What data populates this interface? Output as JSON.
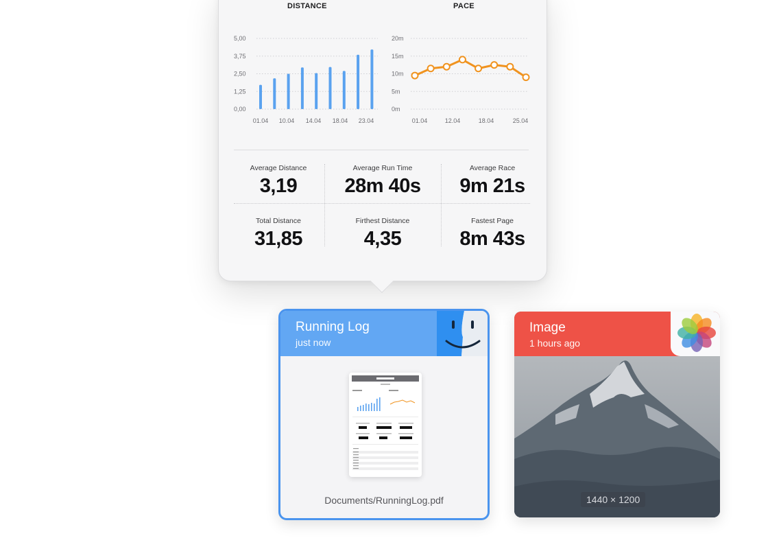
{
  "distance_chart": {
    "title": "DISTANCE",
    "y_ticks": [
      "5,00",
      "3,75",
      "2,50",
      "1,25",
      "0,00"
    ],
    "x_ticks": [
      "01.04",
      "10.04",
      "14.04",
      "18.04",
      "23.04"
    ],
    "color": "#5aa2ef"
  },
  "pace_chart": {
    "title": "PACE",
    "y_ticks": [
      "20m",
      "15m",
      "10m",
      "5m",
      "0m"
    ],
    "x_ticks": [
      "01.04",
      "12.04",
      "18.04",
      "25.04"
    ],
    "color": "#f0931f"
  },
  "chart_data": [
    {
      "type": "bar",
      "title": "DISTANCE",
      "ylim": [
        0,
        5
      ],
      "values": [
        1.72,
        2.18,
        2.5,
        2.95,
        2.55,
        2.98,
        2.7,
        3.85,
        4.22
      ]
    },
    {
      "type": "line",
      "title": "PACE",
      "ylim": [
        0,
        20
      ],
      "values": [
        9.5,
        11.5,
        12,
        14,
        11.5,
        12.5,
        12,
        9
      ]
    }
  ],
  "stats": {
    "avg_distance": {
      "label": "Average Distance",
      "value": "3,19"
    },
    "avg_run_time": {
      "label": "Average Run Time",
      "value": "28m 40s"
    },
    "avg_race": {
      "label": "Average Race",
      "value": "9m 21s"
    },
    "total_distance": {
      "label": "Total Distance",
      "value": "31,85"
    },
    "firthest_distance": {
      "label": "Firthest Distance",
      "value": "4,35"
    },
    "fastest_page": {
      "label": "Fastest Page",
      "value": "8m 43s"
    }
  },
  "running_card": {
    "title": "Running Log",
    "subtitle": "just now",
    "path": "Documents/RunningLog.pdf",
    "accent": "#62a7f3",
    "icon": "finder-icon"
  },
  "image_card": {
    "title": "Image",
    "subtitle": "1 hours ago",
    "dimensions": "1440 × 1200",
    "accent": "#ee5247",
    "icon": "photos-icon"
  }
}
